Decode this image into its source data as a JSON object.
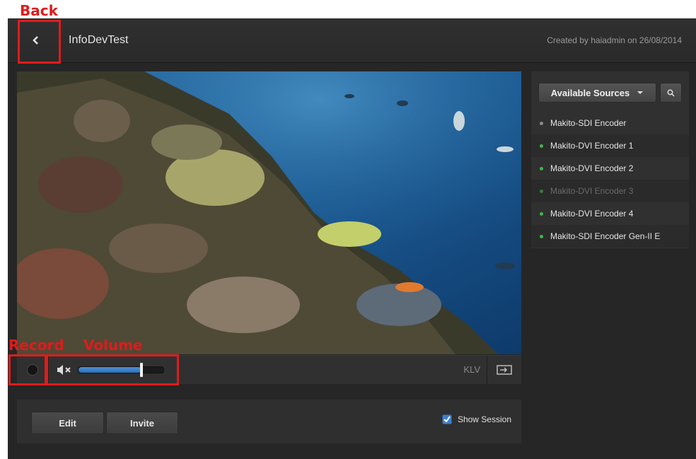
{
  "header": {
    "title": "InfoDevTest",
    "created": "Created by haiadmin on 26/08/2014"
  },
  "controls": {
    "volume_level": 0.74,
    "klv_label": "KLV"
  },
  "actions": {
    "edit_label": "Edit",
    "invite_label": "Invite",
    "show_session_label": "Show Session",
    "show_session_checked": true
  },
  "sources": {
    "dropdown_label": "Available Sources",
    "items": [
      {
        "label": "Makito-SDI Encoder",
        "status": "grey"
      },
      {
        "label": "Makito-DVI Encoder 1",
        "status": "green"
      },
      {
        "label": "Makito-DVI Encoder 2",
        "status": "green"
      },
      {
        "label": "Makito-DVI Encoder 3",
        "status": "green-dim"
      },
      {
        "label": "Makito-DVI Encoder 4",
        "status": "green"
      },
      {
        "label": "Makito-SDI Encoder Gen-II E",
        "status": "green"
      }
    ]
  },
  "annotations": {
    "back": "Back",
    "record": "Record",
    "volume": "Volume"
  },
  "colors": {
    "accent": "#2f6fb5",
    "annotation": "#e01b1b",
    "status_green": "#3fb64a"
  }
}
